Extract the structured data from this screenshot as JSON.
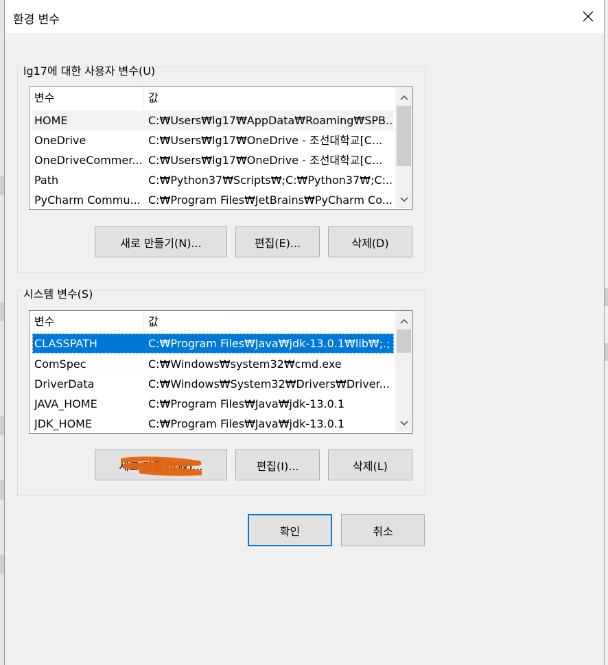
{
  "window": {
    "title": "환경 변수"
  },
  "user_vars": {
    "group_label": "lg17에 대한 사용자 변수(U)",
    "columns": [
      "변수",
      "값"
    ],
    "rows": [
      {
        "name": "HOME",
        "value": "C:₩Users₩lg17₩AppData₩Roaming₩SPB..."
      },
      {
        "name": "OneDrive",
        "value": "C:₩Users₩lg17₩OneDrive - 조선대학교[C..."
      },
      {
        "name": "OneDriveCommer...",
        "value": "C:₩Users₩lg17₩OneDrive - 조선대학교[C..."
      },
      {
        "name": "Path",
        "value": "C:₩Python37₩Scripts₩;C:₩Python37₩;C:..."
      },
      {
        "name": "PyCharm Commu...",
        "value": "C:₩Program Files₩JetBrains₩PyCharm Co..."
      }
    ],
    "buttons": {
      "new": "새로 만들기(N)...",
      "edit": "편집(E)...",
      "delete": "삭제(D)"
    }
  },
  "system_vars": {
    "group_label": "시스템 변수(S)",
    "columns": [
      "변수",
      "값"
    ],
    "rows": [
      {
        "name": "CLASSPATH",
        "value": "C:₩Program Files₩Java₩jdk-13.0.1₩lib₩;.;"
      },
      {
        "name": "ComSpec",
        "value": "C:₩Windows₩system32₩cmd.exe"
      },
      {
        "name": "DriverData",
        "value": "C:₩Windows₩System32₩Drivers₩Driver..."
      },
      {
        "name": "JAVA_HOME",
        "value": "C:₩Program Files₩Java₩jdk-13.0.1"
      },
      {
        "name": "JDK_HOME",
        "value": "C:₩Program Files₩Java₩jdk-13.0.1"
      }
    ],
    "selected_index": 0,
    "buttons": {
      "new": "새로 만들기(W)...",
      "edit": "편집(I)...",
      "delete": "삭제(L)"
    }
  },
  "footer": {
    "ok": "확인",
    "cancel": "취소"
  },
  "colors": {
    "selection": "#0078d7",
    "highlight_scribble": "#e0620d",
    "default_border": "#0078d7"
  },
  "icons": {
    "close": "close-icon",
    "scroll_up": "chevron-up-icon",
    "scroll_down": "chevron-down-icon"
  }
}
